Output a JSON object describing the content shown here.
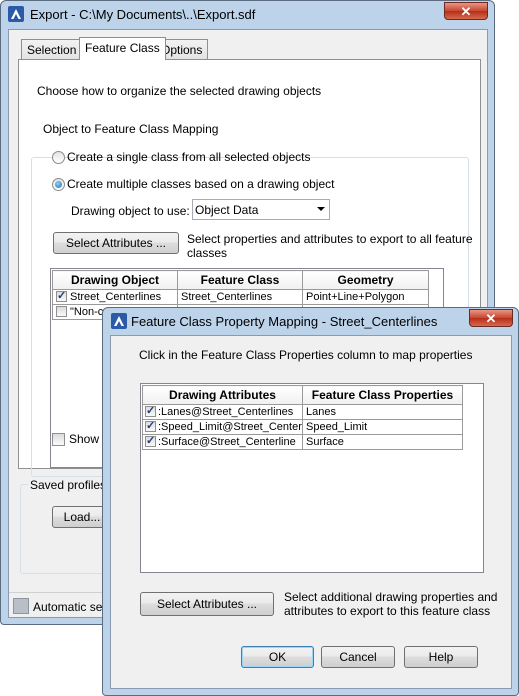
{
  "export_dialog": {
    "title": "Export - C:\\My Documents\\..\\Export.sdf",
    "close_label": "✕",
    "tabs": [
      {
        "label": "Selection"
      },
      {
        "label": "Feature Class"
      },
      {
        "label": "Options"
      }
    ],
    "instruction": "Choose how to organize the selected drawing objects",
    "mapping_group_label": "Object to Feature Class Mapping",
    "radio_single_label": "Create a single class from all selected objects",
    "radio_multiple_label": "Create multiple classes based on a drawing object",
    "drawing_object_label": "Drawing object to use:",
    "drawing_object_value": "Object Data",
    "select_attributes_label": "Select Attributes ...",
    "select_attributes_desc_line1": "Select properties and attributes to export to all feature",
    "select_attributes_desc_line2": "classes",
    "table": {
      "headers": [
        "Drawing Object",
        "Feature Class",
        "Geometry"
      ],
      "rows": [
        {
          "checked": true,
          "drawing_object": "Street_Centerlines",
          "feature_class": "Street_Centerlines",
          "geometry": "Point+Line+Polygon"
        },
        {
          "checked": false,
          "drawing_object": "\"Non-c",
          "feature_class": "",
          "geometry": ""
        }
      ]
    },
    "show_label": "Show so",
    "saved_profiles_label": "Saved profiles",
    "load_label": "Load...",
    "status_text": "Automatic se"
  },
  "mapping_dialog": {
    "title": "Feature Class Property Mapping - Street_Centerlines",
    "close_label": "✕",
    "instruction": "Click in the Feature Class Properties column to map properties",
    "table": {
      "headers": [
        "Drawing Attributes",
        "Feature Class Properties"
      ],
      "rows": [
        {
          "checked": true,
          "attribute": ":Lanes@Street_Centerlines",
          "property": "Lanes"
        },
        {
          "checked": true,
          "attribute": ":Speed_Limit@Street_Center",
          "property": "Speed_Limit"
        },
        {
          "checked": true,
          "attribute": ":Surface@Street_Centerline",
          "property": "Surface"
        }
      ]
    },
    "select_attributes_label": "Select Attributes ...",
    "select_attributes_desc_line1": "Select additional drawing properties and",
    "select_attributes_desc_line2": "attributes to export to this feature class",
    "ok_label": "OK",
    "cancel_label": "Cancel",
    "help_label": "Help"
  },
  "colors": {
    "title_bar": "#bcd3ea",
    "close_button": "#c8452f",
    "client_background": "#f0f0f0",
    "default_button_border": "#3c7fb1"
  }
}
